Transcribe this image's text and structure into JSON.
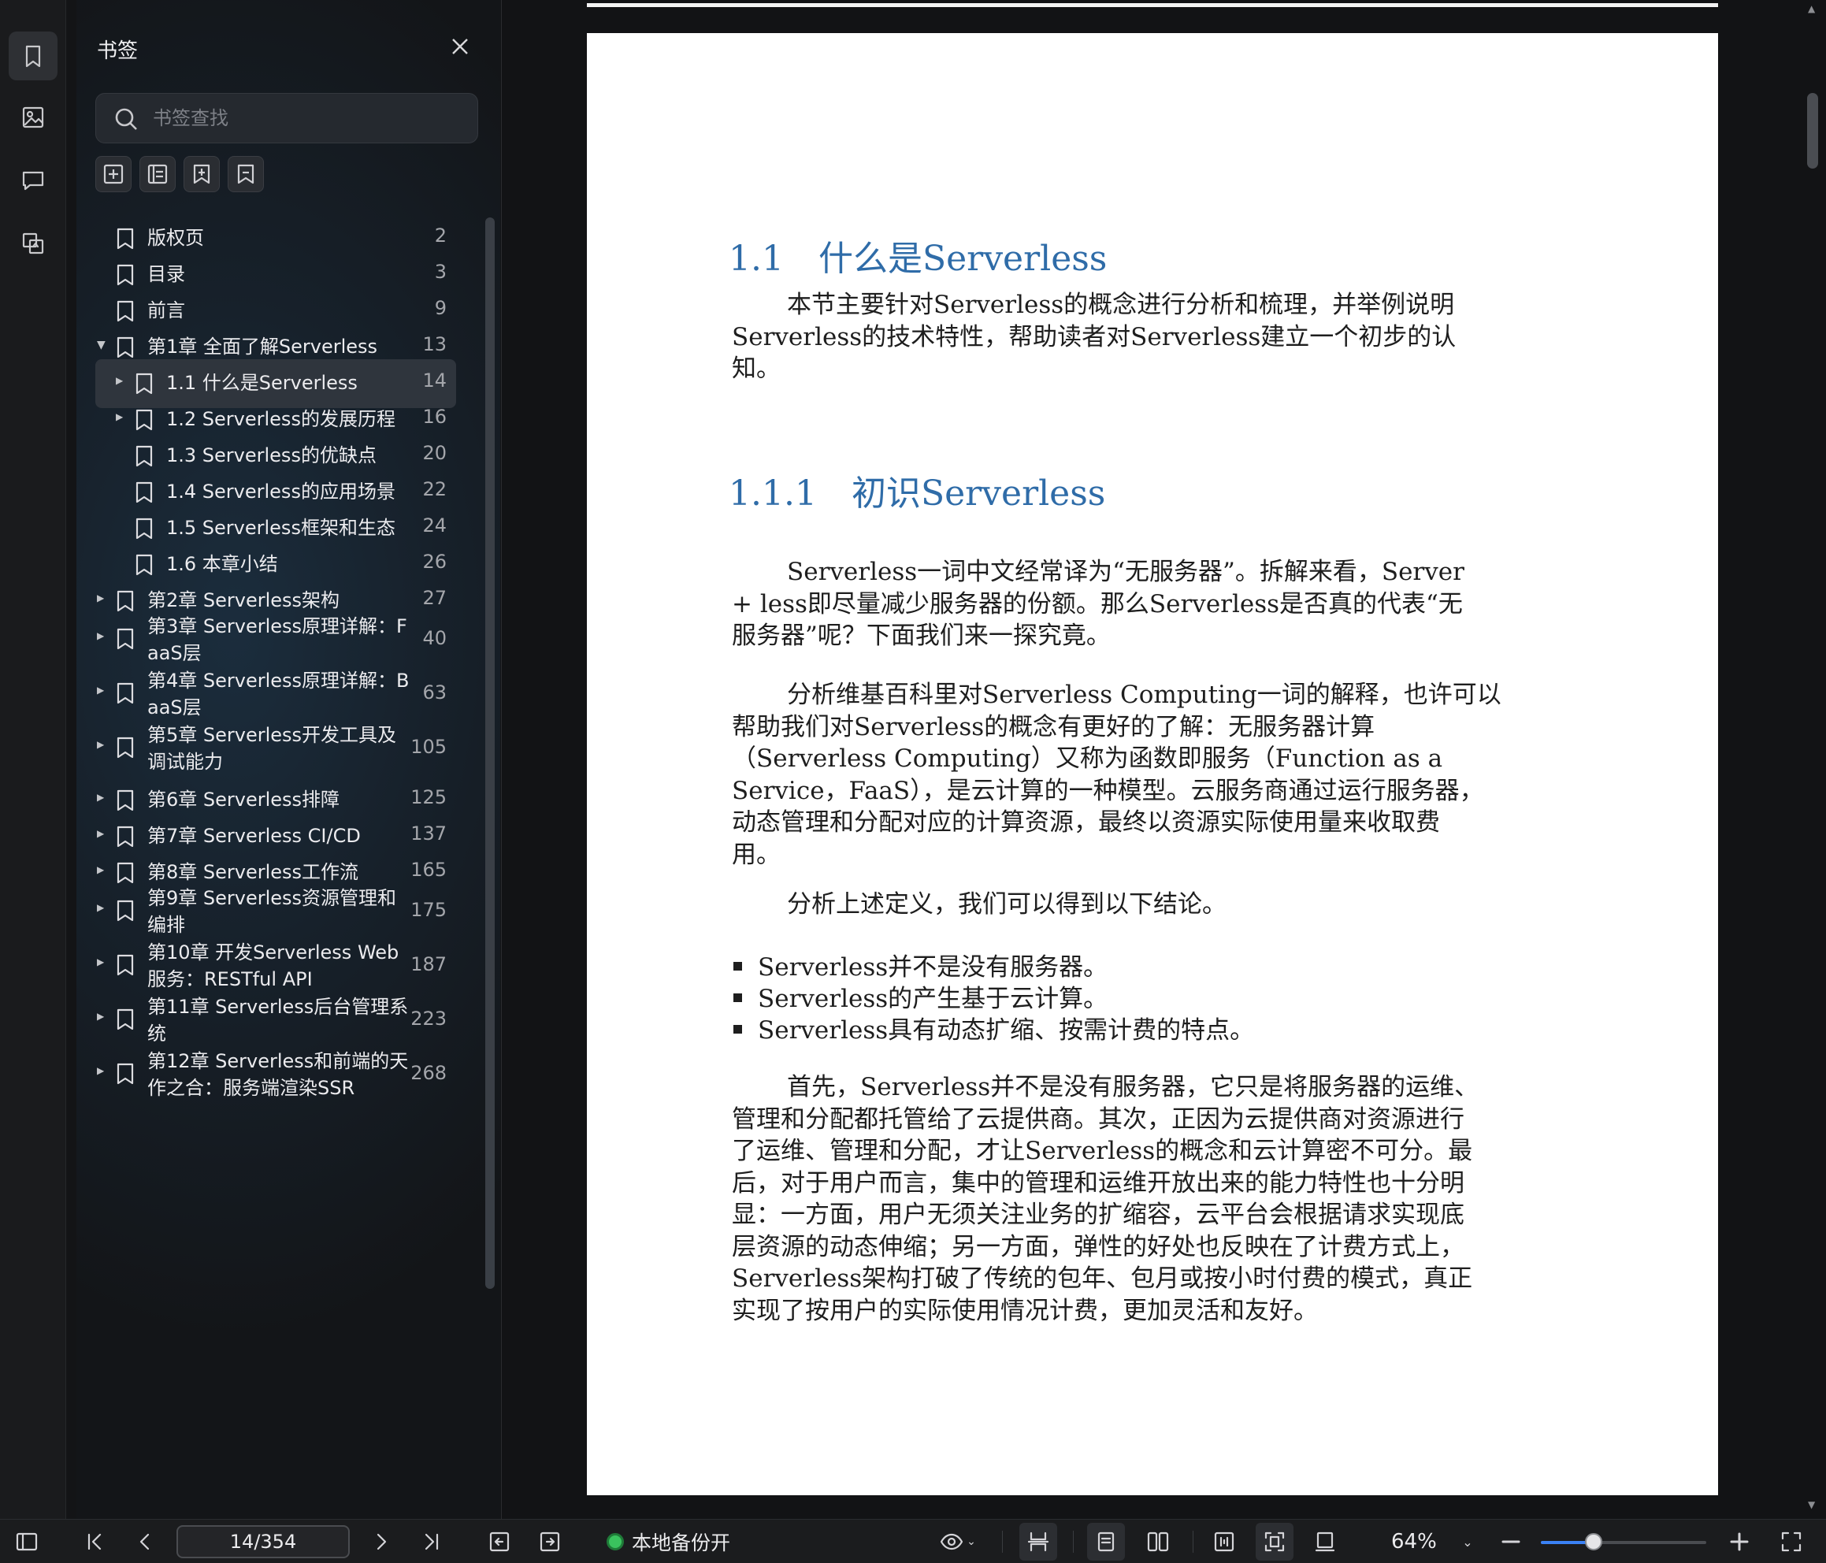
{
  "sidebar_rail": {
    "items": [
      {
        "name": "bookmark-icon",
        "active": true
      },
      {
        "name": "thumbnail-icon",
        "active": false
      },
      {
        "name": "comment-icon",
        "active": false
      },
      {
        "name": "page-extract-icon",
        "active": false
      }
    ]
  },
  "bookmark_panel": {
    "title": "书签",
    "search_placeholder": "书签查找",
    "tools": [
      "add-bookmark-icon",
      "add-child-bookmark-icon",
      "bookmark-import-icon",
      "bookmark-remove-icon"
    ],
    "items": [
      {
        "label": "版权页",
        "page": "2",
        "level": 0,
        "caret": "none"
      },
      {
        "label": "目录",
        "page": "3",
        "level": 0,
        "caret": "none"
      },
      {
        "label": "前言",
        "page": "9",
        "level": 0,
        "caret": "none"
      },
      {
        "label": "第1章 全面了解Serverless",
        "page": "13",
        "level": 0,
        "caret": "open"
      },
      {
        "label": "1.1 什么是Serverless",
        "page": "14",
        "level": 1,
        "caret": "closed",
        "selected": true
      },
      {
        "label": "1.2 Serverless的发展历程",
        "page": "16",
        "level": 1,
        "caret": "closed"
      },
      {
        "label": "1.3 Serverless的优缺点",
        "page": "20",
        "level": 1,
        "caret": "none"
      },
      {
        "label": "1.4 Serverless的应用场景",
        "page": "22",
        "level": 1,
        "caret": "none"
      },
      {
        "label": "1.5 Serverless框架和生态",
        "page": "24",
        "level": 1,
        "caret": "none"
      },
      {
        "label": "1.6 本章小结",
        "page": "26",
        "level": 1,
        "caret": "none"
      },
      {
        "label": "第2章 Serverless架构",
        "page": "27",
        "level": 0,
        "caret": "closed"
      },
      {
        "label": "第3章 Serverless原理详解：F\naaS层",
        "page": "40",
        "level": 0,
        "caret": "closed"
      },
      {
        "label": "第4章 Serverless原理详解：B\naaS层",
        "page": "63",
        "level": 0,
        "caret": "closed"
      },
      {
        "label": "第5章 Serverless开发工具及\n调试能力",
        "page": "105",
        "level": 0,
        "caret": "closed"
      },
      {
        "label": "第6章 Serverless排障",
        "page": "125",
        "level": 0,
        "caret": "closed"
      },
      {
        "label": "第7章 Serverless CI/CD",
        "page": "137",
        "level": 0,
        "caret": "closed"
      },
      {
        "label": "第8章 Serverless工作流",
        "page": "165",
        "level": 0,
        "caret": "closed"
      },
      {
        "label": "第9章 Serverless资源管理和\n编排",
        "page": "175",
        "level": 0,
        "caret": "closed"
      },
      {
        "label": "第10章 开发Serverless Web\n服务：RESTful API",
        "page": "187",
        "level": 0,
        "caret": "closed"
      },
      {
        "label": "第11章 Serverless后台管理系\n统",
        "page": "223",
        "level": 0,
        "caret": "closed"
      },
      {
        "label": "第12章 Serverless和前端的天\n作之合：服务端渲染SSR",
        "page": "268",
        "level": 0,
        "caret": "closed"
      }
    ]
  },
  "document": {
    "heading1": "1.1　什么是Serverless",
    "intro": "本节主要针对Serverless的概念进行分析和梳理，并举例说明\nServerless的技术特性，帮助读者对Serverless建立一个初步的认\n知。",
    "heading2": "1.1.1　初识Serverless",
    "para1": "Serverless一词中文经常译为“无服务器”。拆解来看，Server\n+ less即尽量减少服务器的份额。那么Serverless是否真的代表“无\n服务器”呢？下面我们来一探究竟。",
    "para2": "分析维基百科里对Serverless Computing一词的解释，也许可以\n帮助我们对Serverless的概念有更好的了解：无服务器计算\n（Serverless Computing）又称为函数即服务（Function as a\nService，FaaS），是云计算的一种模型。云服务商通过运行服务器，\n动态管理和分配对应的计算资源，最终以资源实际使用量来收取费\n用。",
    "para3": "分析上述定义，我们可以得到以下结论。",
    "bullets": [
      "Serverless并不是没有服务器。",
      "Serverless的产生基于云计算。",
      "Serverless具有动态扩缩、按需计费的特点。"
    ],
    "para4": "首先，Serverless并不是没有服务器，它只是将服务器的运维、\n管理和分配都托管给了云提供商。其次，正因为云提供商对资源进行\n了运维、管理和分配，才让Serverless的概念和云计算密不可分。最\n后，对于用户而言，集中的管理和运维开放出来的能力特性也十分明\n显：一方面，用户无须关注业务的扩缩容，云平台会根据请求实现底\n层资源的动态伸缩；另一方面，弹性的好处也反映在了计费方式上，\nServerless架构打破了传统的包年、包月或按小时付费的模式，真正\n实现了按用户的实际使用情况计费，更加灵活和友好。"
  },
  "toolbar": {
    "page_value": "14/354",
    "backup_label": "本地备份开",
    "zoom_label": "64%",
    "zoom_fraction": 0.32,
    "accent": "#3b82f6",
    "backup_status_color": "#3ac35e"
  }
}
